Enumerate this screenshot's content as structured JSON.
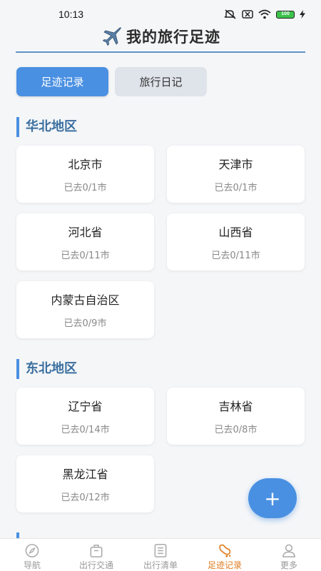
{
  "status_bar": {
    "time": "10:13",
    "battery": "100"
  },
  "header": {
    "title": "我的旅行足迹"
  },
  "tabs": [
    {
      "label": "足迹记录",
      "active": true
    },
    {
      "label": "旅行日记",
      "active": false
    }
  ],
  "regions": [
    {
      "title": "华北地区",
      "cards": [
        {
          "name": "北京市",
          "count": "已去0/1市"
        },
        {
          "name": "天津市",
          "count": "已去0/1市"
        },
        {
          "name": "河北省",
          "count": "已去0/11市"
        },
        {
          "name": "山西省",
          "count": "已去0/11市"
        },
        {
          "name": "内蒙古自治区",
          "count": "已去0/9市"
        }
      ]
    },
    {
      "title": "东北地区",
      "cards": [
        {
          "name": "辽宁省",
          "count": "已去0/14市"
        },
        {
          "name": "吉林省",
          "count": "已去0/8市"
        },
        {
          "name": "黑龙江省",
          "count": "已去0/12市"
        }
      ]
    }
  ],
  "fab": {
    "label": "+"
  },
  "bottom_nav": [
    {
      "label": "导航",
      "icon": "compass-icon",
      "active": false
    },
    {
      "label": "出行交通",
      "icon": "suitcase-icon",
      "active": false
    },
    {
      "label": "出行清单",
      "icon": "checklist-icon",
      "active": false
    },
    {
      "label": "足迹记录",
      "icon": "footprint-icon",
      "active": true
    },
    {
      "label": "更多",
      "icon": "person-icon",
      "active": false
    }
  ],
  "colors": {
    "accent": "#4a90e2",
    "region_title": "#3a6f9f",
    "nav_active": "#e07b20"
  }
}
